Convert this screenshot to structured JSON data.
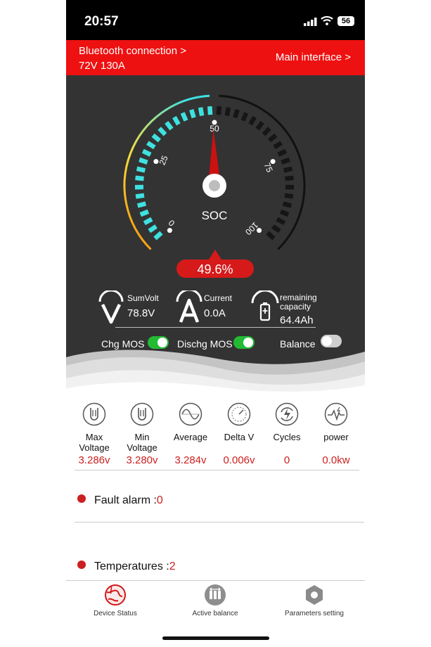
{
  "status_bar": {
    "time": "20:57",
    "battery": "56"
  },
  "header": {
    "bluetooth_label": "Bluetooth connection >",
    "device_label": "72V 130A",
    "main_interface_label": "Main interface >"
  },
  "gauge": {
    "label": "SOC",
    "ticks": [
      "0",
      "25",
      "50",
      "75",
      "100"
    ],
    "value_text": "49.6%",
    "soc_percent": 49.6
  },
  "stats": {
    "sumvolt": {
      "label": "SumVolt",
      "value": "78.8V"
    },
    "current": {
      "label": "Current",
      "value": "0.0A"
    },
    "capacity": {
      "label_line1": "remaining",
      "label_line2": "capacity",
      "value": "64.4Ah"
    }
  },
  "switches": {
    "chg": {
      "label": "Chg MOS",
      "on": true
    },
    "dischg": {
      "label": "Dischg MOS",
      "on": true
    },
    "balance": {
      "label": "Balance",
      "on": false
    }
  },
  "metrics": [
    {
      "label1": "Max",
      "label2": "Voltage",
      "value": "3.286v",
      "icon": "max-voltage-icon"
    },
    {
      "label1": "Min",
      "label2": "Voltage",
      "value": "3.280v",
      "icon": "min-voltage-icon"
    },
    {
      "label1": "Average",
      "label2": "",
      "value": "3.284v",
      "icon": "sine-wave-icon"
    },
    {
      "label1": "Delta V",
      "label2": "",
      "value": "0.006v",
      "icon": "delta-gauge-icon"
    },
    {
      "label1": "Cycles",
      "label2": "",
      "value": "0",
      "icon": "cycle-bolt-icon"
    },
    {
      "label1": "power",
      "label2": "",
      "value": "0.0kw",
      "icon": "power-pulse-icon"
    }
  ],
  "alarms": {
    "fault": {
      "label": "Fault alarm :",
      "value": "0"
    },
    "temps": {
      "label": "Temperatures :",
      "value": "2"
    }
  },
  "tabs": [
    {
      "label": "Device Status",
      "icon": "globe-icon",
      "active": true
    },
    {
      "label": "Active balance",
      "icon": "balance-icon",
      "active": false
    },
    {
      "label": "Parameters setting",
      "icon": "hexagon-gear-icon",
      "active": false
    }
  ],
  "colors": {
    "accent_red": "#ee1111",
    "value_red": "#cc1f1f",
    "gauge_cyan": "#3fe0e0",
    "toggle_green": "#22bb33"
  }
}
